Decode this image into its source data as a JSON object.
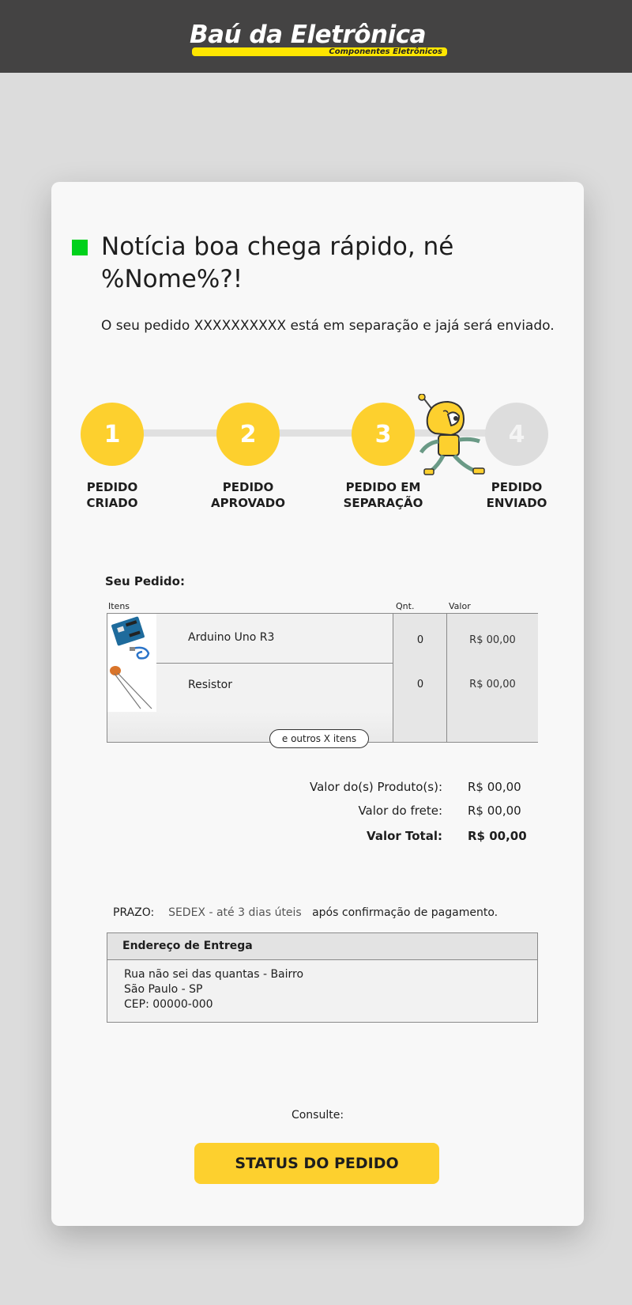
{
  "header": {
    "logo_title": "Baú da Eletrônica",
    "logo_subtitle": "Componentes Eletrônicos",
    "logo_bar_color": "#ffe600"
  },
  "message": {
    "headline": "Notícia boa chega rápido, né %Nome%?!",
    "subtitle": "O seu pedido XXXXXXXXXX  está em separação e jajá será enviado."
  },
  "progress": {
    "current_step": 3,
    "steps": [
      {
        "number": "1",
        "label": "PEDIDO\nCRIADO",
        "state": "done"
      },
      {
        "number": "2",
        "label": "PEDIDO\nAPROVADO",
        "state": "done"
      },
      {
        "number": "3",
        "label": "PEDIDO EM\nSEPARAÇÃO",
        "state": "done"
      },
      {
        "number": "4",
        "label": "PEDIDO\nENVIADO",
        "state": "pending"
      }
    ],
    "done_color": "#fdd02e",
    "pending_color": "#dddddd"
  },
  "order": {
    "title": "Seu Pedido:",
    "columns": {
      "items": "Itens",
      "qty": "Qnt.",
      "value": "Valor"
    },
    "items": [
      {
        "name": "Arduino Uno R3",
        "qty": "0",
        "value": "R$ 00,00"
      },
      {
        "name": "Resistor",
        "qty": "0",
        "value": "R$ 00,00"
      }
    ],
    "more_label": "e outros X itens"
  },
  "summary": {
    "products_label": "Valor do(s) Produto(s):",
    "products_value": "R$ 00,00",
    "shipping_label": "Valor do frete:",
    "shipping_value": "R$ 00,00",
    "total_label": "Valor Total:",
    "total_value": "R$ 00,00"
  },
  "delivery": {
    "prazo_label": "PRAZO:",
    "prazo_method": "SEDEX - até 3 dias úteis",
    "prazo_note": "após confirmação de pagamento.",
    "address_title": "Endereço de Entrega",
    "address_lines": [
      "Rua não sei das quantas - Bairro",
      "São Paulo - SP",
      "CEP: 00000-000"
    ]
  },
  "cta": {
    "consulte_label": "Consulte:",
    "button_label": "STATUS DO PEDIDO",
    "button_color": "#fdd02e"
  },
  "icons": {
    "status_marker": "green-square-icon",
    "mascot": "robot-mascot-icon",
    "arduino": "arduino-board-icon",
    "resistor": "resistor-icon"
  }
}
